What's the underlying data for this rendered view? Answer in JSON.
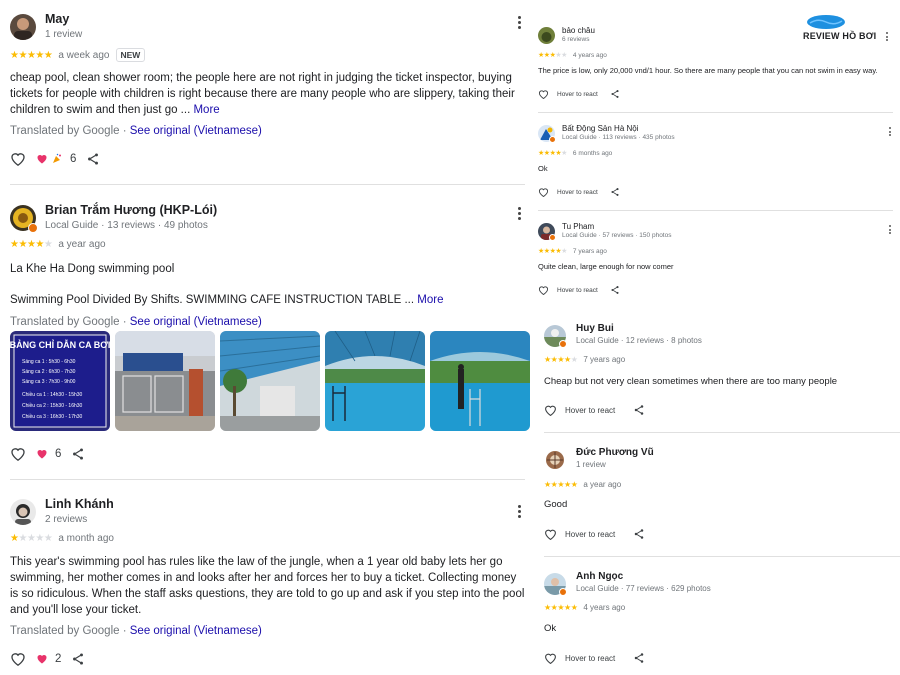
{
  "left_reviews": [
    {
      "name": "May",
      "meta": "1 review",
      "rating": 5,
      "time": "a week ago",
      "badge": "NEW",
      "text": "cheap pool, clean shower room; the people here are not right in judging the ticket inspector, buying tickets for people with children is right because there are many people who are slippery, taking their children to swim and then just go ... ",
      "more": "More",
      "translated": "Translated by Google · ",
      "see_original": "See original (Vietnamese)",
      "reaction_count": "6"
    },
    {
      "name": "Brian Trắm Hương (HKP-Lói)",
      "meta": "Local Guide · 13 reviews · 49 photos",
      "rating": 4,
      "time": "a year ago",
      "text": "La Khe Ha Dong swimming pool",
      "text2": "Swimming Pool Divided By Shifts. SWIMMING CAFE INSTRUCTION TABLE ... ",
      "more": "More",
      "translated": "Translated by Google · ",
      "see_original": "See original (Vietnamese)",
      "reaction_count": "6",
      "photo_sign": {
        "title": "BẢNG CHỈ DẪN CA BƠI",
        "lines": [
          "Sáng ca 1 : 5h30 - 6h30",
          "Sáng ca 2 : 6h30 - 7h30",
          "Sáng ca 3 : 7h30 - 9h00",
          "Chiều ca 1 : 14h30 - 15h30",
          "Chiều ca 2 : 15h30 - 16h30",
          "Chiều ca 3 : 16h30 - 17h30"
        ]
      }
    },
    {
      "name": "Linh Khánh",
      "meta": "2 reviews",
      "rating": 1,
      "time": "a month ago",
      "text": "This year's swimming pool has rules like the law of the jungle, when a 1 year old baby lets her go swimming, her mother comes in and looks after her and forces her to buy a ticket. Collecting money is so ridiculous. When the staff asks questions, they are told to go up and ask if you step into the pool and you'll lose your ticket.",
      "translated": "Translated by Google · ",
      "see_original": "See original (Vietnamese)",
      "reaction_count": "2"
    }
  ],
  "logo": {
    "text": "REVIEW HỒ BƠI"
  },
  "right_small_reviews": [
    {
      "name": "bảo châu",
      "meta": "6 reviews",
      "rating": 3,
      "time": "4 years ago",
      "text": "The price is low, only 20,000 vnd/1 hour. So there are many people that you can not swim in easy way.",
      "react": "Hover to react"
    },
    {
      "name": "Bất Động Sản Hà Nội",
      "meta": "Local Guide · 113 reviews · 435 photos",
      "rating": 4,
      "time": "6 months ago",
      "text": "Ok",
      "react": "Hover to react"
    },
    {
      "name": "Tu Pham",
      "meta": "Local Guide · 57 reviews · 150 photos",
      "rating": 4,
      "time": "7 years ago",
      "text": "Quite clean, large enough for now comer",
      "react": "Hover to react"
    }
  ],
  "right_medium_reviews": [
    {
      "name": "Huy Bui",
      "meta": "Local Guide · 12 reviews · 8 photos",
      "rating": 4,
      "time": "7 years ago",
      "text": "Cheap but not very clean sometimes when there are too many people",
      "react": "Hover to react"
    },
    {
      "name": "Đức Phương Vũ",
      "meta": "1 review",
      "rating": 5,
      "time": "a year ago",
      "text": "Good",
      "react": "Hover to react"
    },
    {
      "name": "Anh Ngọc",
      "meta": "Local Guide · 77 reviews · 629 photos",
      "rating": 5,
      "time": "4 years ago",
      "text": "Ok",
      "react": "Hover to react"
    }
  ],
  "colors": {
    "star": "#fbbc04",
    "link": "#1a0dab",
    "local_guide_badge": "#e8710a"
  }
}
